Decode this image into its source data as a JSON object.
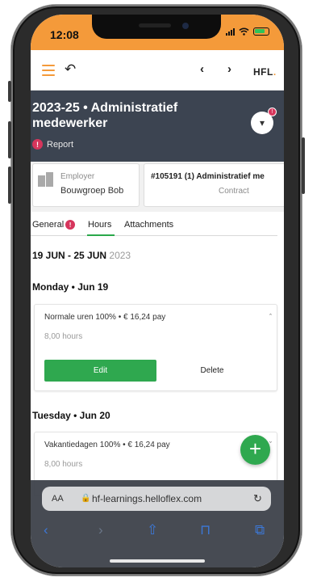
{
  "status_bar": {
    "time": "12:08"
  },
  "toolbar": {
    "undo_icon": "↶",
    "prev_icon": "‹",
    "next_icon": "›",
    "brand": "HFL",
    "brand_dot": "."
  },
  "header": {
    "title": "2023-25 • Administratief medewerker",
    "report_label": "Report",
    "alert_mark": "!",
    "toggle_icon": "▾",
    "badge_mark": "!"
  },
  "cards": {
    "employer_label": "Employer",
    "employer_value": "Bouwgroep Bob",
    "contract_title": "#105191 (1) Administratief me",
    "contract_label": "Contract"
  },
  "tabs": {
    "general": "General",
    "general_alert": "!",
    "hours": "Hours",
    "attachments": "Attachments"
  },
  "week": {
    "range": "19 JUN - 25 JUN",
    "year": "2023"
  },
  "days": [
    {
      "heading": "Monday • Jun 19",
      "entry": "Normale uren 100% • € 16,24 pay",
      "hours": "8,00 hours",
      "chevron": "ˆ",
      "edit": "Edit",
      "delete": "Delete"
    },
    {
      "heading": "Tuesday • Jun 20",
      "entry": "Vakantiedagen 100% • € 16,24 pay",
      "hours": "8,00 hours",
      "chevron": "ˇ"
    }
  ],
  "fab": {
    "label": "+"
  },
  "safari": {
    "text_size": "AA",
    "lock": "🔒",
    "url": "hf-learnings.helloflex.com",
    "reload": "↻",
    "back": "‹",
    "forward": "›",
    "share": "⇧",
    "bookmarks": "⊓",
    "tabs": "⧉"
  },
  "colors": {
    "accent": "#f49a3a",
    "header_bg": "#3c4451",
    "primary_button": "#2fa84f",
    "alert": "#d6355c"
  }
}
